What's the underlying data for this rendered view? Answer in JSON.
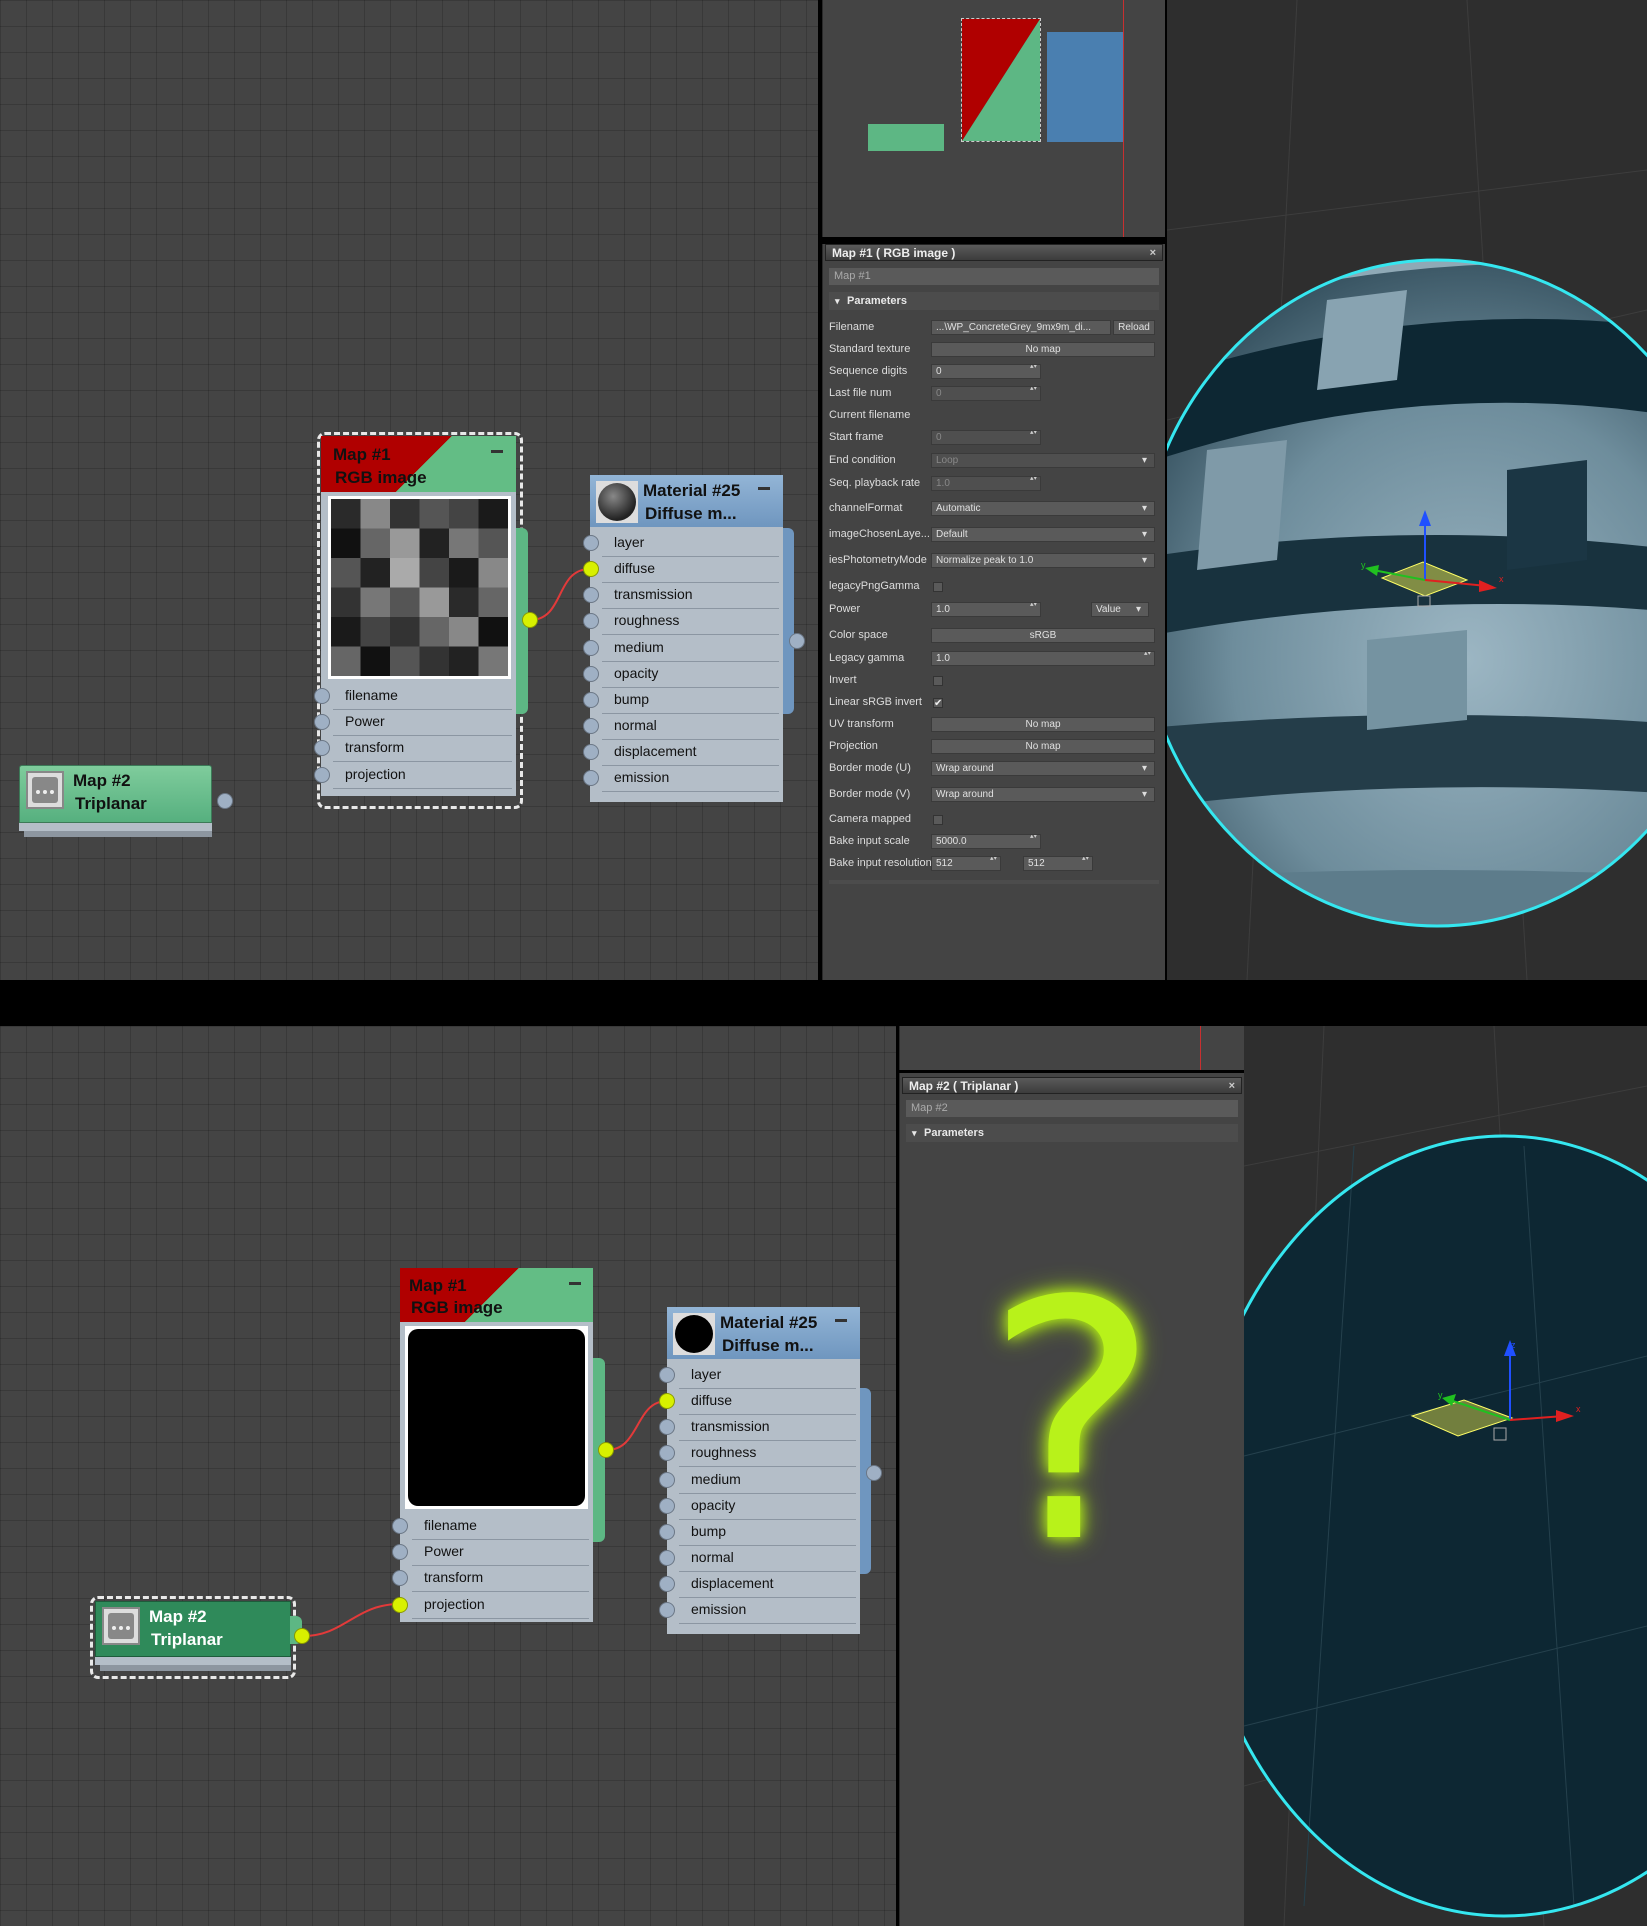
{
  "top": {
    "node_map1": {
      "name": "Map #1",
      "type": "RGB image",
      "slots": [
        "filename",
        "Power",
        "transform",
        "projection"
      ]
    },
    "node_material": {
      "name": "Material #25",
      "type": "Diffuse m...",
      "slots": [
        "layer",
        "diffuse",
        "transmission",
        "roughness",
        "medium",
        "opacity",
        "bump",
        "normal",
        "displacement",
        "emission"
      ],
      "connected_slot": "diffuse"
    },
    "node_map2": {
      "name": "Map #2",
      "type": "Triplanar"
    },
    "props": {
      "title": "Map #1  ( RGB image )",
      "name_value": "Map #1",
      "section": "Parameters",
      "rows": {
        "filename": {
          "label": "Filename",
          "value": "...\\WP_ConcreteGrey_9mx9m_di...",
          "button": "Reload"
        },
        "standard_texture": {
          "label": "Standard texture",
          "value": "No map"
        },
        "sequence_digits": {
          "label": "Sequence digits",
          "value": "0"
        },
        "last_file_num": {
          "label": "Last file num",
          "value": "0"
        },
        "current_filename": {
          "label": "Current filename"
        },
        "start_frame": {
          "label": "Start frame",
          "value": "0"
        },
        "end_condition": {
          "label": "End condition",
          "value": "Loop"
        },
        "seq_playback_rate": {
          "label": "Seq. playback rate",
          "value": "1.0"
        },
        "channel_format": {
          "label": "channelFormat",
          "value": "Automatic"
        },
        "image_chosen_layer": {
          "label": "imageChosenLaye...",
          "value": "Default"
        },
        "ies_photometry": {
          "label": "iesPhotometryMode",
          "value": "Normalize peak to 1.0"
        },
        "legacy_png_gamma": {
          "label": "legacyPngGamma"
        },
        "power": {
          "label": "Power",
          "value": "1.0",
          "mode": "Value"
        },
        "color_space": {
          "label": "Color space",
          "value": "sRGB"
        },
        "legacy_gamma": {
          "label": "Legacy gamma",
          "value": "1.0"
        },
        "invert": {
          "label": "Invert"
        },
        "linear_srgb_invert": {
          "label": "Linear sRGB invert",
          "check": "✔"
        },
        "uv_transform": {
          "label": "UV transform",
          "value": "No map"
        },
        "projection": {
          "label": "Projection",
          "value": "No map"
        },
        "border_u": {
          "label": "Border mode (U)",
          "value": "Wrap around"
        },
        "border_v": {
          "label": "Border mode (V)",
          "value": "Wrap around"
        },
        "camera_mapped": {
          "label": "Camera mapped"
        },
        "bake_input_scale": {
          "label": "Bake input scale",
          "value": "5000.0"
        },
        "bake_input_resolution": {
          "label": "Bake input resolution",
          "value1": "512",
          "value2": "512"
        }
      }
    },
    "gizmo": {
      "x": "x",
      "y": "y"
    }
  },
  "bottom": {
    "node_map1": {
      "name": "Map #1",
      "type": "RGB image",
      "slots": [
        "filename",
        "Power",
        "transform",
        "projection"
      ],
      "connected_slot": "projection"
    },
    "node_material": {
      "name": "Material #25",
      "type": "Diffuse m...",
      "slots": [
        "layer",
        "diffuse",
        "transmission",
        "roughness",
        "medium",
        "opacity",
        "bump",
        "normal",
        "displacement",
        "emission"
      ],
      "connected_slot": "diffuse"
    },
    "node_map2": {
      "name": "Map #2",
      "type": "Triplanar"
    },
    "props": {
      "title": "Map #2  ( Triplanar )",
      "name_value": "Map #2",
      "section": "Parameters"
    },
    "question_mark": "?",
    "gizmo": {
      "x": "x",
      "y": "y",
      "z": "z"
    }
  },
  "colors": {
    "map_node_green": "#5db784",
    "map_node_red": "#b00000",
    "material_node_blue": "#6f96bf",
    "wire_red": "#e23a3a",
    "active_socket": "#d8f000",
    "selection_cyan": "#35e7f0",
    "question_mark": "#b8f21a"
  }
}
